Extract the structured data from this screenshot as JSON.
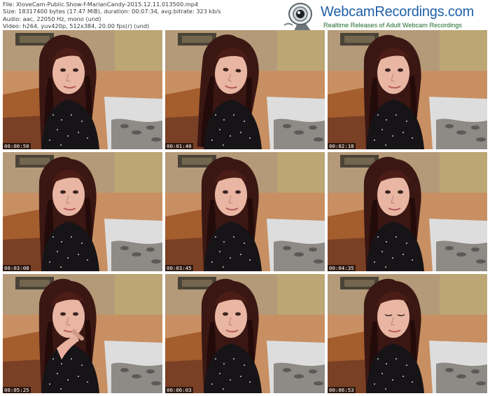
{
  "header": {
    "lines": [
      "File: XloveCam-Public.Show-f-MarianCandy-2015.12.11.013500.mp4",
      "Size: 18317400 bytes (17.47 MiB), duration: 00:07:34, avg.bitrate: 323 kb/s",
      "Audio: aac, 22050 Hz, mono (und)",
      "Video: h264, yuv420p, 512x384, 20.00 fps(r) (und)"
    ]
  },
  "logo": {
    "title": "WebcamRecordings.com",
    "tagline": "Realtime Releases of Adult Webcam Recordings",
    "icon": "webcam-icon",
    "colors": {
      "title": "#1f5fa8",
      "tagline": "#1b6b2a"
    }
  },
  "thumbnails": [
    {
      "timestamp": "00:00:50",
      "pose": "straight"
    },
    {
      "timestamp": "00:01:40",
      "pose": "tilt-right"
    },
    {
      "timestamp": "00:02:18",
      "pose": "straight"
    },
    {
      "timestamp": "00:03:08",
      "pose": "straight"
    },
    {
      "timestamp": "00:03:45",
      "pose": "straight"
    },
    {
      "timestamp": "00:04:35",
      "pose": "straight"
    },
    {
      "timestamp": "00:05:25",
      "pose": "hand-on-chin"
    },
    {
      "timestamp": "00:06:03",
      "pose": "straight"
    },
    {
      "timestamp": "00:06:53",
      "pose": "eyes-closed"
    }
  ]
}
